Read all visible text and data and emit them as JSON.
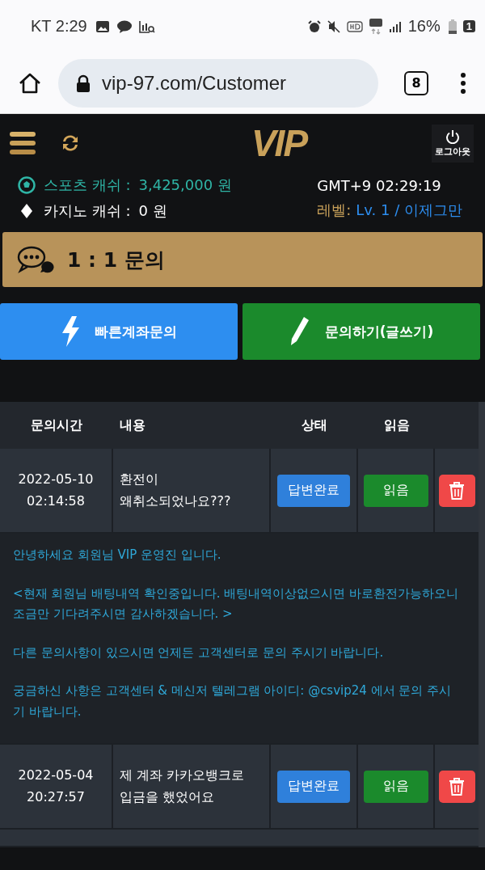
{
  "status_bar": {
    "carrier": "KT",
    "time": "2:29",
    "battery": "16%",
    "sim": "1"
  },
  "browser": {
    "url": "vip-97.com/Customer",
    "tab_count": "8"
  },
  "header": {
    "logo": "VIP",
    "logout": "로그아웃"
  },
  "account": {
    "sports_label": "스포츠 캐쉬 :",
    "sports_value": "3,425,000 원",
    "casino_label": "카지노 캐쉬 :",
    "casino_value": "0 원",
    "clock": "GMT+9 02:29:19",
    "level_label": "레벨:",
    "level_value": "Lv. 1 / 이제그만"
  },
  "page_title": "1 : 1 문의",
  "actions": [
    {
      "label": "빠른계좌문의",
      "kind": "quick"
    },
    {
      "label": "문의하기(글쓰기)",
      "kind": "write"
    }
  ],
  "table": {
    "columns": [
      "문의시간",
      "내용",
      "상태",
      "읽음"
    ],
    "rows": [
      {
        "datetime": "2022-05-10\n02:14:58",
        "content": "환전이\n왜취소되었나요???",
        "status": "답변완료",
        "read": "읽음",
        "answer": [
          "안녕하세요 회원님 VIP 운영진 입니다.",
          "<현재 회원님 배팅내역 확인중입니다. 배팅내역이상없으시면 바로환전가능하오니 조금만 기다려주시면 감사하겠습니다. >",
          "다른 문의사항이 있으시면 언제든 고객센터로 문의 주시기 바랍니다.",
          "궁금하신 사항은 고객센터 & 메신저 텔레그램 아이디: @csvip24 에서 문의 주시기 바랍니다."
        ]
      },
      {
        "datetime": "2022-05-04\n20:27:57",
        "content": "제 계좌 카카오뱅크로\n입금을 했었어요",
        "status": "답변완료",
        "read": "읽음"
      }
    ]
  }
}
